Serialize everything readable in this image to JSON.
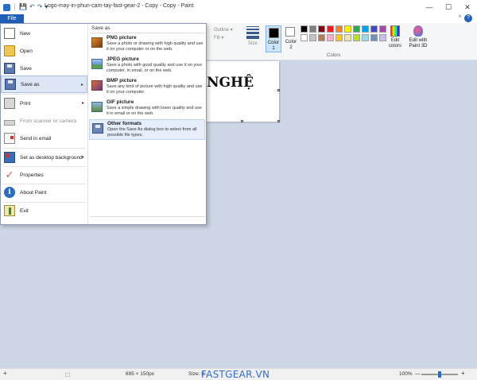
{
  "window": {
    "title": "Logo-may-in-phun-cam-tay-fast-gear-2 - Copy - Copy - Paint",
    "controls": {
      "minimize": "—",
      "maximize": "☐",
      "close": "✕"
    }
  },
  "quick_access": {
    "save": "💾",
    "undo": "↶",
    "redo": "↷",
    "customize": "▾"
  },
  "ribbon": {
    "file_tab": "File",
    "help": "?",
    "collapse": "^",
    "outline_label": "Outline",
    "fill_label": "Fill",
    "size_label": "Size",
    "color1_label": "Color 1",
    "color1_line1": "Color",
    "color1_line2": "1",
    "color2_line1": "Color",
    "color2_line2": "2",
    "edit_colors_line1": "Edit",
    "edit_colors_line2": "colors",
    "paint3d_line1": "Edit with",
    "paint3d_line2": "Paint 3D",
    "colors_group_label": "Colors",
    "palette": [
      "#000000",
      "#7f7f7f",
      "#880015",
      "#ed1c24",
      "#ff7f27",
      "#fff200",
      "#22b14c",
      "#00a2e8",
      "#3f48cc",
      "#a349a4",
      "#ffffff",
      "#c3c3c3",
      "#b97a57",
      "#ffaec9",
      "#ffc90e",
      "#efe4b0",
      "#b5e61d",
      "#99d9ea",
      "#7092be",
      "#c8bfe7"
    ]
  },
  "canvas": {
    "text": "NGHỆ"
  },
  "file_menu": {
    "items": [
      {
        "label": "New",
        "icon": "new-doc-icon"
      },
      {
        "label": "Open",
        "icon": "open-folder-icon"
      },
      {
        "label": "Save",
        "icon": "save-disk-icon"
      },
      {
        "label": "Save as",
        "icon": "save-as-icon",
        "arrow": "▸"
      },
      {
        "label": "Print",
        "icon": "printer-icon",
        "arrow": "▸"
      },
      {
        "label": "From scanner or camera",
        "icon": "scanner-icon"
      },
      {
        "label": "Send in email",
        "icon": "email-icon"
      },
      {
        "label": "Set as desktop background",
        "icon": "desktop-icon",
        "arrow": "▸"
      },
      {
        "label": "Properties",
        "icon": "checkmark-icon"
      },
      {
        "label": "About Paint",
        "icon": "info-icon"
      },
      {
        "label": "Exit",
        "icon": "exit-icon"
      }
    ],
    "check_glyph": "✓",
    "info_glyph": "i",
    "save_as": {
      "heading": "Save as",
      "options": [
        {
          "title": "PNG picture",
          "desc": "Save a photo or drawing with high quality and use it on your computer or on the web."
        },
        {
          "title": "JPEG picture",
          "desc": "Save a photo with good quality and use it on your computer, in email, or on the web."
        },
        {
          "title": "BMP picture",
          "desc": "Save any kind of picture with high quality and use it on your computer."
        },
        {
          "title": "GIF picture",
          "desc": "Save a simple drawing with lower quality and use it in email or on the web."
        },
        {
          "title": "Other formats",
          "desc": "Open the Save As dialog box to select from all possible file types."
        }
      ]
    }
  },
  "status_bar": {
    "add_icon": "+",
    "selection_icon": "⬚",
    "dimensions": "695 × 150px",
    "size_label": "Size: 8...",
    "brand": "FASTGEAR.VN",
    "zoom": "100%",
    "zoom_out": "—",
    "zoom_in": "+",
    "zoom_fraction": 0.5
  }
}
